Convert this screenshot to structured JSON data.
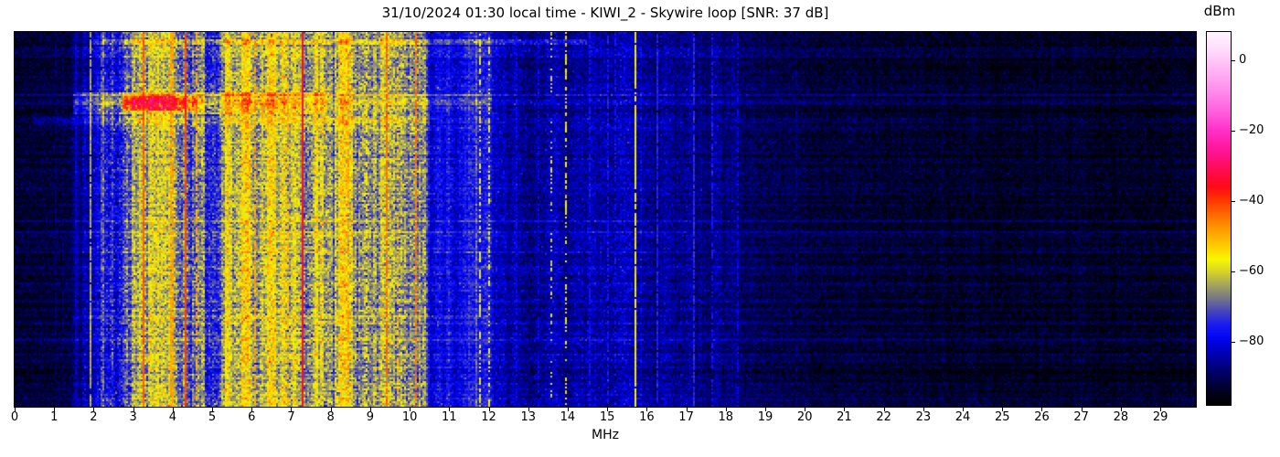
{
  "title": "31/10/2024 01:30 local time - KIWI_2 - Skywire loop [SNR: 37 dB]",
  "x_axis": {
    "label": "MHz",
    "tick_values": [
      0,
      1,
      2,
      3,
      4,
      5,
      6,
      7,
      8,
      9,
      10,
      11,
      12,
      13,
      14,
      15,
      16,
      17,
      18,
      19,
      20,
      21,
      22,
      23,
      24,
      25,
      26,
      27,
      28,
      29
    ],
    "fmin": 0,
    "fmax": 29.9
  },
  "colorbar": {
    "label": "dBm",
    "tick_values": [
      0,
      -20,
      -40,
      -60,
      -80
    ],
    "tick_labels": [
      "0",
      "−20",
      "−40",
      "−60",
      "−80"
    ],
    "vmin": -98,
    "vmax": 8
  },
  "chart_data": {
    "type": "heatmap",
    "subtype": "radio-spectrogram-waterfall",
    "title": "31/10/2024 01:30 local time - KIWI_2 - Skywire loop [SNR: 37 dB]",
    "xlabel": "MHz",
    "zlabel": "dBm",
    "x_range_mhz": [
      0,
      29.9
    ],
    "z_range_dbm": [
      -98,
      8
    ],
    "snr_db": 37,
    "seed": 20241031,
    "colormap": [
      [
        -98,
        "#000000"
      ],
      [
        -95,
        "#000016"
      ],
      [
        -91,
        "#000048"
      ],
      [
        -87,
        "#000080"
      ],
      [
        -83,
        "#0000b8"
      ],
      [
        -80,
        "#0004e0"
      ],
      [
        -78,
        "#060af8"
      ],
      [
        -75,
        "#1c1cee"
      ],
      [
        -71,
        "#4a4ab8"
      ],
      [
        -67.5,
        "#787888"
      ],
      [
        -63.5,
        "#a8a85a"
      ],
      [
        -60,
        "#d8d42a"
      ],
      [
        -56.5,
        "#f8f800"
      ],
      [
        -53,
        "#ffd000"
      ],
      [
        -48,
        "#ff9c00"
      ],
      [
        -44,
        "#ff6c00"
      ],
      [
        -40,
        "#ff3c00"
      ],
      [
        -36,
        "#ff0a16"
      ],
      [
        -31,
        "#ff0c54"
      ],
      [
        -26,
        "#ff1494"
      ],
      [
        -20,
        "#ff30c8"
      ],
      [
        -15,
        "#ff5cdc"
      ],
      [
        -9,
        "#ff8aec"
      ],
      [
        -3,
        "#ffb4f4"
      ],
      [
        3,
        "#ffdcfc"
      ],
      [
        8,
        "#fff4ff"
      ]
    ],
    "noise_floor_points": [
      [
        0,
        -93
      ],
      [
        1.4,
        -92
      ],
      [
        1.55,
        -86
      ],
      [
        1.9,
        -83
      ],
      [
        2.1,
        -79
      ],
      [
        2.4,
        -73
      ],
      [
        2.8,
        -68
      ],
      [
        3.2,
        -64
      ],
      [
        3.8,
        -63
      ],
      [
        4.3,
        -66
      ],
      [
        4.9,
        -68
      ],
      [
        5.4,
        -62
      ],
      [
        6.0,
        -60
      ],
      [
        6.6,
        -61
      ],
      [
        7.1,
        -62
      ],
      [
        7.45,
        -68
      ],
      [
        7.8,
        -64
      ],
      [
        8.3,
        -62
      ],
      [
        9.0,
        -64
      ],
      [
        9.8,
        -63
      ],
      [
        10.35,
        -66
      ],
      [
        10.5,
        -79
      ],
      [
        11.3,
        -78
      ],
      [
        11.9,
        -75
      ],
      [
        12.25,
        -81
      ],
      [
        12.6,
        -85
      ],
      [
        13.2,
        -86
      ],
      [
        13.9,
        -84
      ],
      [
        14.6,
        -83
      ],
      [
        15.2,
        -84
      ],
      [
        15.9,
        -85
      ],
      [
        16.6,
        -86
      ],
      [
        17.3,
        -86
      ],
      [
        18.1,
        -87
      ],
      [
        18.7,
        -89
      ],
      [
        19.5,
        -91
      ],
      [
        21,
        -92.5
      ],
      [
        23,
        -93.5
      ],
      [
        26,
        -94
      ],
      [
        29.9,
        -94.5
      ]
    ],
    "mottle_bands": [
      {
        "f0": 1.6,
        "f1": 2.15,
        "amp": 4
      },
      {
        "f0": 2.15,
        "f1": 7.9,
        "amp": 7.5
      },
      {
        "f0": 7.9,
        "f1": 10.45,
        "amp": 7.5
      },
      {
        "f0": 10.5,
        "f1": 11.5,
        "amp": 3.5
      },
      {
        "f0": 11.5,
        "f1": 12.18,
        "amp": 6
      },
      {
        "f0": 12.18,
        "f1": 18.6,
        "amp": 2.5
      },
      {
        "f0": 18.6,
        "f1": 29.9,
        "amp": 1.2
      }
    ],
    "dark_bands": [
      {
        "f0": 2.52,
        "f1": 2.95,
        "drop": 7
      },
      {
        "f0": 4.82,
        "f1": 5.22,
        "drop": 8
      }
    ],
    "carrier_lines": [
      {
        "f": 1.02,
        "level": -88,
        "duty": 0.55
      },
      {
        "f": 1.22,
        "level": -88,
        "duty": 0.45
      },
      {
        "f": 1.55,
        "level": -82,
        "duty": 0.9
      },
      {
        "f": 1.93,
        "level": -63,
        "duty": 0.9
      },
      {
        "f": 2.18,
        "level": -70,
        "duty": 0.6
      },
      {
        "f": 3.27,
        "level": -43,
        "duty": 0.95
      },
      {
        "f": 3.62,
        "level": -55,
        "duty": 0.6
      },
      {
        "f": 3.95,
        "level": -49,
        "duty": 0.75,
        "w": 2
      },
      {
        "f": 4.33,
        "level": -41,
        "duty": 0.95
      },
      {
        "f": 4.62,
        "level": -50,
        "duty": 0.7
      },
      {
        "f": 5.35,
        "level": -55,
        "duty": 0.55
      },
      {
        "f": 6.1,
        "level": -49,
        "duty": 0.7
      },
      {
        "f": 6.58,
        "level": -54,
        "duty": 0.55
      },
      {
        "f": 6.9,
        "level": -51,
        "duty": 0.6
      },
      {
        "f": 7.29,
        "level": -35,
        "duty": 1.0
      },
      {
        "f": 7.64,
        "level": -55,
        "duty": 0.5
      },
      {
        "f": 8.1,
        "level": -56,
        "duty": 0.5
      },
      {
        "f": 8.45,
        "level": -48,
        "duty": 0.55
      },
      {
        "f": 8.9,
        "level": -56,
        "duty": 0.5
      },
      {
        "f": 9.4,
        "level": -44,
        "duty": 0.85
      },
      {
        "f": 9.7,
        "level": -52,
        "duty": 0.5
      },
      {
        "f": 10.16,
        "level": -45,
        "duty": 0.8
      },
      {
        "f": 11.77,
        "level": -57,
        "duty": 0.5
      },
      {
        "f": 12.0,
        "level": -57,
        "duty": 0.45
      },
      {
        "f": 12.7,
        "level": -78,
        "duty": 0.6
      },
      {
        "f": 13.25,
        "level": -79,
        "duty": 0.5
      },
      {
        "f": 13.57,
        "level": -60,
        "duty": 0.3
      },
      {
        "f": 13.97,
        "level": -58,
        "duty": 0.4
      },
      {
        "f": 14.55,
        "level": -77,
        "duty": 0.6
      },
      {
        "f": 15.0,
        "level": -76,
        "duty": 0.6
      },
      {
        "f": 15.21,
        "level": -77,
        "duty": 0.5
      },
      {
        "f": 15.73,
        "level": -56,
        "duty": 0.92
      },
      {
        "f": 16.25,
        "level": -75,
        "duty": 0.8
      },
      {
        "f": 17.2,
        "level": -74,
        "duty": 0.8
      },
      {
        "f": 17.66,
        "level": -76,
        "duty": 0.65
      },
      {
        "f": 18.3,
        "level": -79,
        "duty": 0.55
      },
      {
        "f": 19.8,
        "level": -86,
        "duty": 0.4
      }
    ],
    "time_events": [
      {
        "t0": 0.015,
        "t1": 0.032,
        "f0": 2.0,
        "f1": 14.5,
        "boost": 8
      },
      {
        "t0": 0.16,
        "t1": 0.216,
        "f0": 1.5,
        "f1": 7.9,
        "boost": 10
      },
      {
        "t0": 0.17,
        "t1": 0.208,
        "f0": 2.75,
        "f1": 4.65,
        "boost": 17
      },
      {
        "t0": 0.162,
        "t1": 0.214,
        "f0": 7.9,
        "f1": 12.1,
        "boost": 4
      },
      {
        "t0": 0.224,
        "t1": 0.246,
        "f0": 0.45,
        "f1": 10.5,
        "boost": 4.5
      },
      {
        "t0": 0.752,
        "t1": 0.764,
        "f0": 1.5,
        "f1": 12.0,
        "boost": 5
      }
    ]
  }
}
